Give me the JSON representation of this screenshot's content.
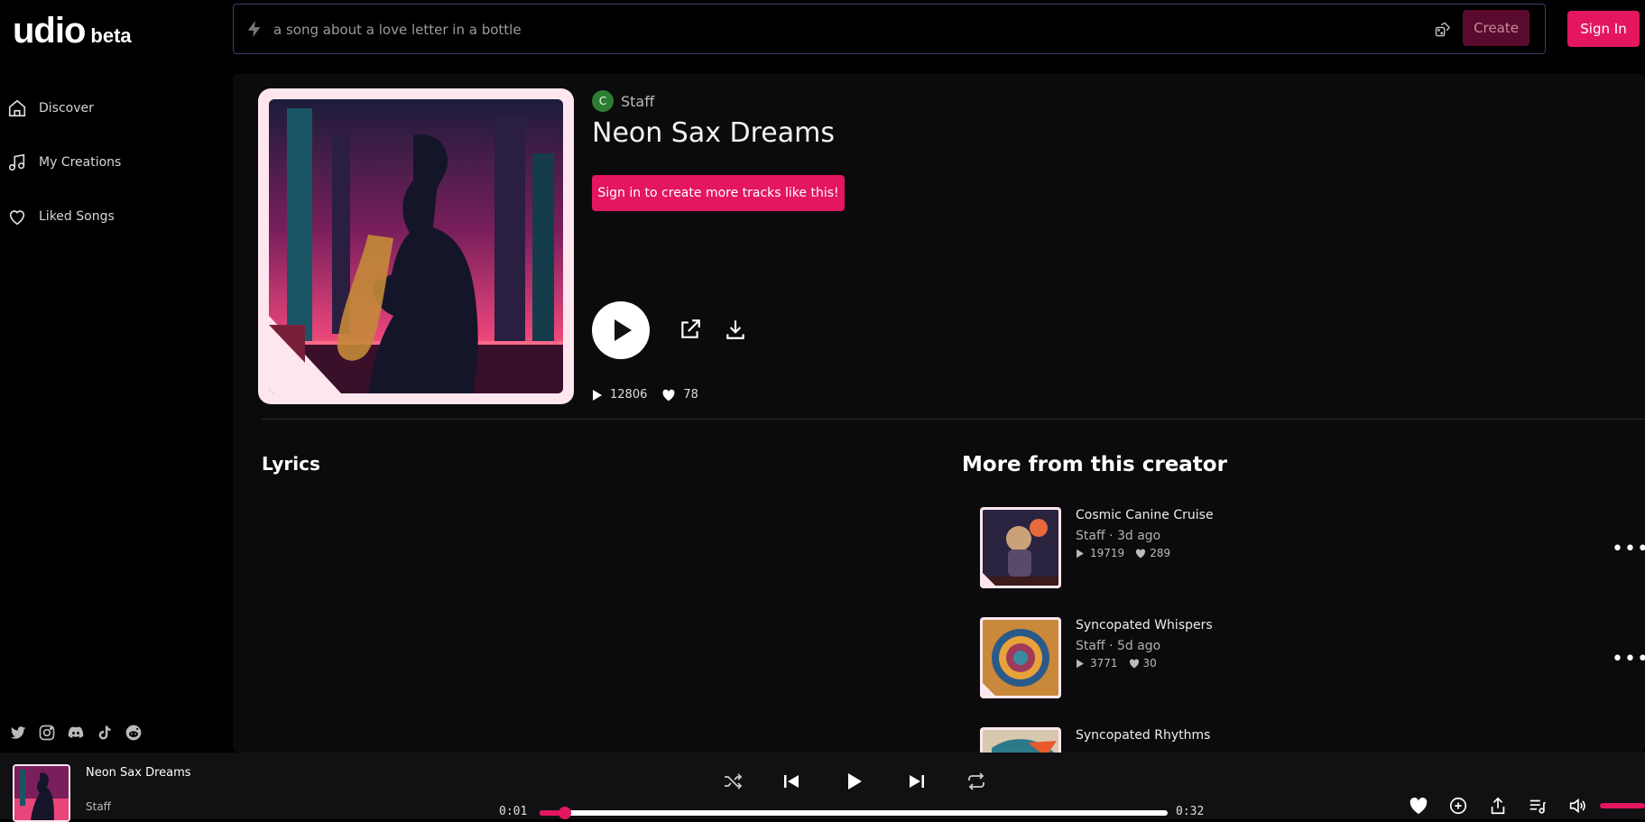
{
  "app": {
    "logo_main": "udio",
    "logo_badge": "beta",
    "accent_color": "#e3165f"
  },
  "sidebar": {
    "items": [
      {
        "label": "Discover",
        "icon": "home-icon"
      },
      {
        "label": "My Creations",
        "icon": "music-note-icon"
      },
      {
        "label": "Liked Songs",
        "icon": "heart-icon"
      }
    ],
    "socials": [
      "twitter-icon",
      "instagram-icon",
      "discord-icon",
      "tiktok-icon",
      "reddit-icon"
    ]
  },
  "topbar": {
    "prompt_placeholder": "a song about a love letter in a bottle",
    "create_label": "Create",
    "signin_label": "Sign In"
  },
  "track": {
    "creator_initial": "C",
    "creator": "Staff",
    "title": "Neon Sax Dreams",
    "cta_label": "Sign in to create more tracks like this!",
    "plays": "12806",
    "likes": "78"
  },
  "lyrics": {
    "heading": "Lyrics"
  },
  "more_from_creator": {
    "heading": "More from this creator",
    "tracks": [
      {
        "title": "Cosmic Canine Cruise",
        "artist": "Staff",
        "age": "3d ago",
        "plays": "19719",
        "likes": "289"
      },
      {
        "title": "Syncopated Whispers",
        "artist": "Staff",
        "age": "5d ago",
        "plays": "3771",
        "likes": "30"
      },
      {
        "title": "Syncopated Rhythms",
        "artist": "",
        "age": "",
        "plays": "",
        "likes": ""
      }
    ]
  },
  "player": {
    "title": "Neon Sax Dreams",
    "artist": "Staff",
    "current_time": "0:01",
    "duration": "0:32",
    "progress": 0.04
  }
}
